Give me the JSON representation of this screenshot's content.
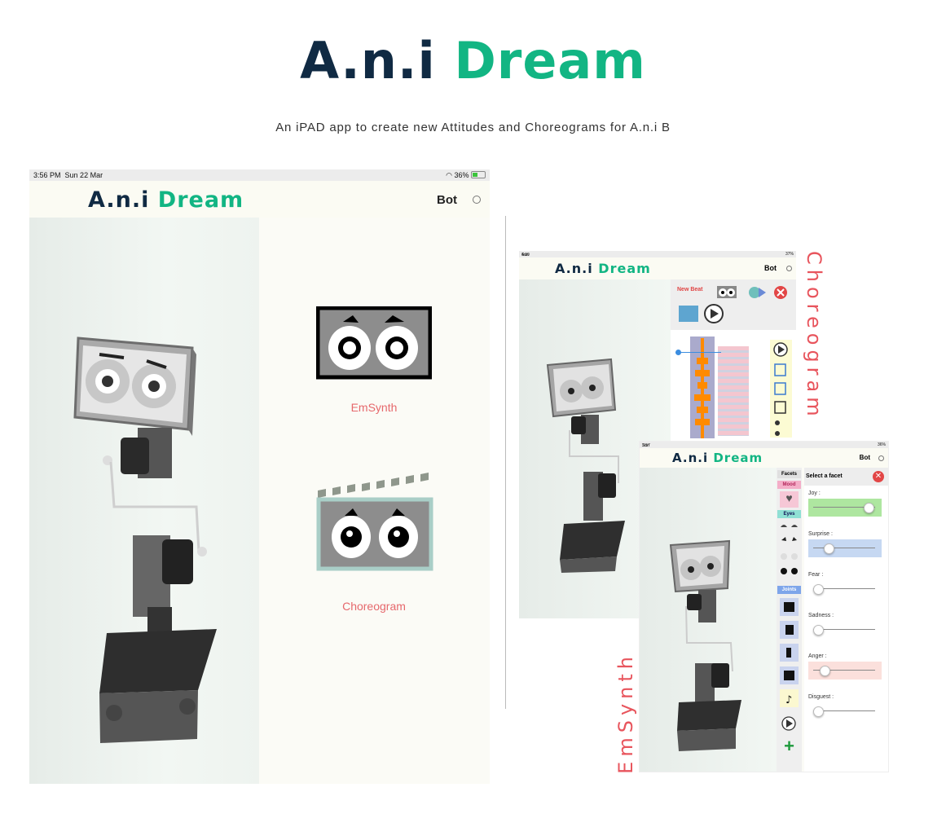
{
  "header": {
    "title_part1": "A.n.i",
    "title_part2": "Dream",
    "subtitle": "An iPAD app to create new Attitudes and Choreograms for A.n.i B"
  },
  "main_screen": {
    "status": {
      "time": "3:56 PM",
      "date": "Sun 22 Mar",
      "battery": "36%"
    },
    "nav": {
      "logo_part1": "A.n.i",
      "logo_part2": "Dream",
      "device": "Bot"
    },
    "choices": [
      {
        "label": "EmSynth"
      },
      {
        "label": "Choreogram"
      }
    ]
  },
  "choreogram_screen": {
    "status": {
      "time": "4:00 PM",
      "date": "Sun 22 Mar",
      "battery": "37%"
    },
    "nav": {
      "logo_part1": "A.n.i",
      "logo_part2": "Dream",
      "device": "Bot"
    },
    "toolbar": {
      "new_beat": "New Beat"
    },
    "side_label": "Choreogram"
  },
  "emsynth_screen": {
    "status": {
      "time": "3:57 PM",
      "date": "Sun 22 Mar",
      "battery": "36%"
    },
    "nav": {
      "logo_part1": "A.n.i",
      "logo_part2": "Dream",
      "device": "Bot"
    },
    "facets": {
      "header": "Facets",
      "mood": "Mood",
      "eyes": "Eyes",
      "joints": "Joints"
    },
    "panel_title": "Select a facet",
    "sliders": [
      {
        "label": "Joy :",
        "value": 0.88,
        "color": "#aee6a0"
      },
      {
        "label": "Surprise :",
        "value": 0.18,
        "color": "#c6d8f2"
      },
      {
        "label": "Fear :",
        "value": 0.0,
        "color": ""
      },
      {
        "label": "Sadness :",
        "value": 0.0,
        "color": ""
      },
      {
        "label": "Anger :",
        "value": 0.12,
        "color": "#fbe0dc"
      },
      {
        "label": "Disguest :",
        "value": 0.0,
        "color": ""
      }
    ],
    "side_label": "EmSynth"
  },
  "colors": {
    "brand_dark": "#102a43",
    "brand_green": "#12b583",
    "accent_red": "#e8555d"
  }
}
